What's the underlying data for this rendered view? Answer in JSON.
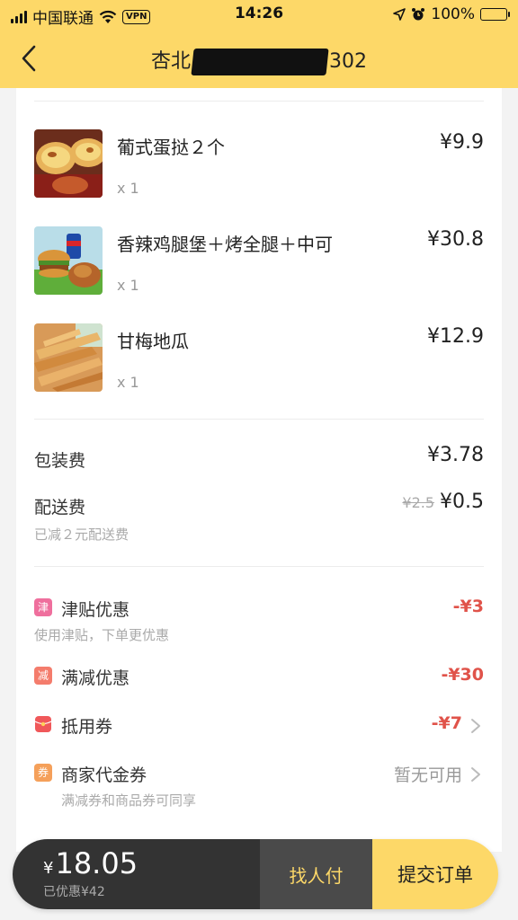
{
  "status_bar": {
    "carrier": "中国联通",
    "vpn": "VPN",
    "time": "14:26",
    "battery": "100%"
  },
  "nav": {
    "title_prefix": "杏北",
    "title_suffix": "302"
  },
  "items": [
    {
      "name": "葡式蛋挞２个",
      "price": "¥9.9",
      "qty": "x 1",
      "image": "egg-tart-photo"
    },
    {
      "name": "香辣鸡腿堡＋烤全腿＋中可",
      "price": "¥30.8",
      "qty": "x 1",
      "image": "burger-combo-photo"
    },
    {
      "name": "甘梅地瓜",
      "price": "¥12.9",
      "qty": "x 1",
      "image": "sweet-potato-fries-photo"
    }
  ],
  "fees": {
    "packaging_label": "包装费",
    "packaging_value": "¥3.78",
    "delivery_label": "配送费",
    "delivery_original": "¥2.5",
    "delivery_value": "¥0.5",
    "delivery_note": "已减２元配送费"
  },
  "discounts": {
    "jintie": {
      "icon": "津",
      "label": "津贴优惠",
      "value": "-¥3",
      "note": "使用津贴，下单更优惠",
      "color": "#ef6f9d"
    },
    "manjian": {
      "icon": "减",
      "label": "满减优惠",
      "value": "-¥30",
      "color": "#f47c6c"
    },
    "coupon": {
      "label": "抵用券",
      "value": "-¥7",
      "color": "#f0585a"
    },
    "merchant": {
      "icon": "券",
      "label": "商家代金券",
      "value": "暂无可用",
      "note": "满减券和商品券可同享",
      "color": "#f5a05a"
    }
  },
  "bottom": {
    "currency": "¥",
    "total": "18.05",
    "saved": "已优惠¥42",
    "friend_pay": "找人付",
    "submit": "提交订单"
  },
  "colors": {
    "brand_yellow": "#fdd868",
    "discount_red": "#e0534a",
    "dark": "#333333"
  }
}
